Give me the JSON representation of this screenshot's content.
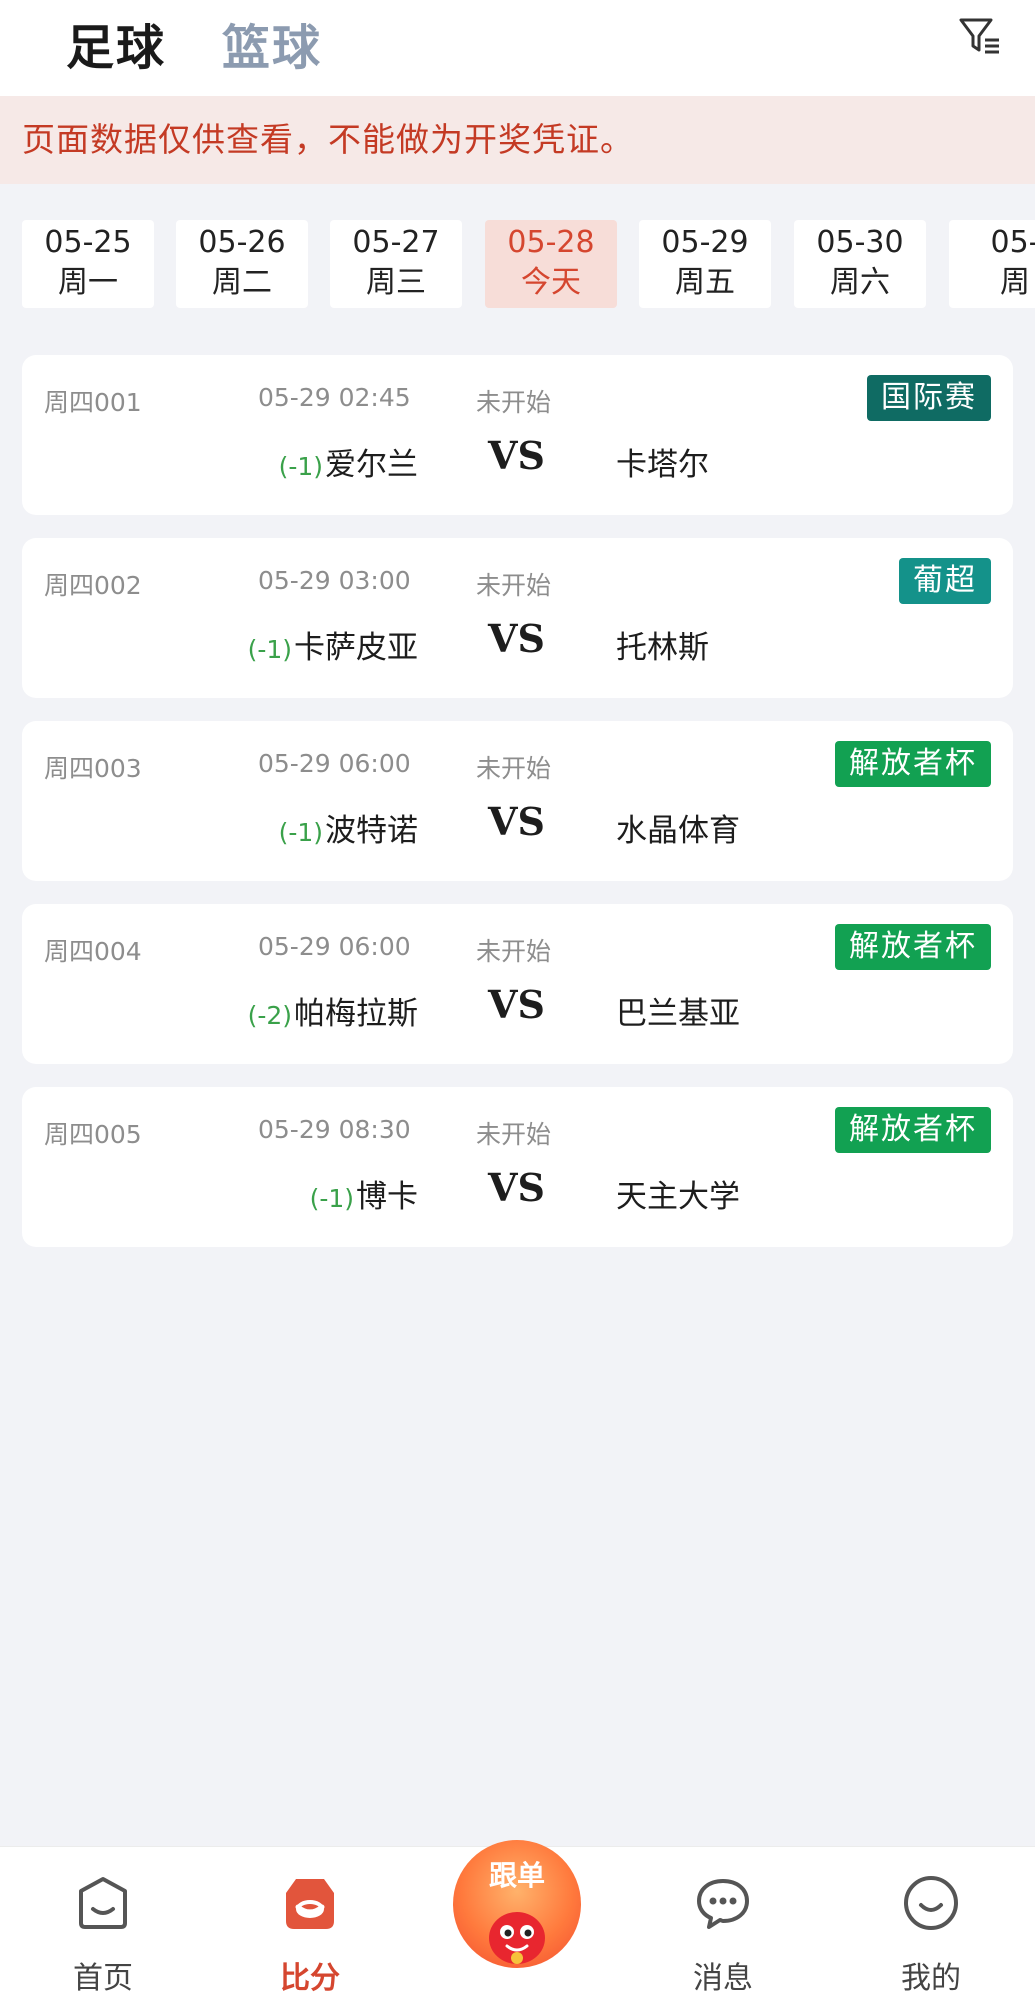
{
  "top_tabs": {
    "football": "足球",
    "basketball": "篮球"
  },
  "notice": "页面数据仅供查看，不能做为开奖凭证。",
  "dates": [
    {
      "date": "05-25",
      "weekday": "周一"
    },
    {
      "date": "05-26",
      "weekday": "周二"
    },
    {
      "date": "05-27",
      "weekday": "周三"
    },
    {
      "date": "05-28",
      "weekday": "今天"
    },
    {
      "date": "05-29",
      "weekday": "周五"
    },
    {
      "date": "05-30",
      "weekday": "周六"
    },
    {
      "date": "05-",
      "weekday": "周"
    }
  ],
  "colors": {
    "accent": "#d5462f",
    "handicap": "#3aa14a",
    "league_international": "#0f6b63",
    "league_portugal": "#14928a",
    "league_libertadores": "#12a152"
  },
  "matches": [
    {
      "code": "周四001",
      "time": "05-29 02:45",
      "status": "未开始",
      "league": "国际赛",
      "league_color": "#0f6b63",
      "handicap": "(-1)",
      "home": "爱尔兰",
      "vs": "VS",
      "away": "卡塔尔"
    },
    {
      "code": "周四002",
      "time": "05-29 03:00",
      "status": "未开始",
      "league": "葡超",
      "league_color": "#14928a",
      "handicap": "(-1)",
      "home": "卡萨皮亚",
      "vs": "VS",
      "away": "托林斯"
    },
    {
      "code": "周四003",
      "time": "05-29 06:00",
      "status": "未开始",
      "league": "解放者杯",
      "league_color": "#12a152",
      "handicap": "(-1)",
      "home": "波特诺",
      "vs": "VS",
      "away": "水晶体育"
    },
    {
      "code": "周四004",
      "time": "05-29 06:00",
      "status": "未开始",
      "league": "解放者杯",
      "league_color": "#12a152",
      "handicap": "(-2)",
      "home": "帕梅拉斯",
      "vs": "VS",
      "away": "巴兰基亚"
    },
    {
      "code": "周四005",
      "time": "05-29 08:30",
      "status": "未开始",
      "league": "解放者杯",
      "league_color": "#12a152",
      "handicap": "(-1)",
      "home": "博卡",
      "vs": "VS",
      "away": "天主大学"
    }
  ],
  "bottom_nav": {
    "home": {
      "label": "首页",
      "icon": "home-icon"
    },
    "score": {
      "label": "比分",
      "icon": "score-icon"
    },
    "follow": {
      "label": "跟单",
      "icon": "mascot-icon"
    },
    "messages": {
      "label": "消息",
      "icon": "chat-icon"
    },
    "me": {
      "label": "我的",
      "icon": "smile-icon"
    }
  }
}
